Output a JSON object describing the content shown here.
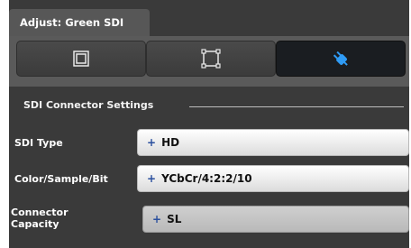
{
  "window": {
    "title": "Adjust: Green SDI"
  },
  "tabs": [
    {
      "name": "picture",
      "icon": "square-frame-icon",
      "selected": false
    },
    {
      "name": "crop",
      "icon": "crop-corners-icon",
      "selected": false
    },
    {
      "name": "connector",
      "icon": "plug-icon",
      "selected": true
    }
  ],
  "section": {
    "title": "SDI Connector Settings"
  },
  "fields": [
    {
      "label": "SDI Type",
      "value": "HD",
      "prefix": "+"
    },
    {
      "label": "Color/Sample/Bit",
      "value": "YCbCr/4:2:2/10",
      "prefix": "+"
    },
    {
      "label_line1": "Connector",
      "label_line2": "Capacity",
      "value": "SL",
      "prefix": "+",
      "enabled": false
    }
  ],
  "colors": {
    "accent": "#2f9bf5",
    "panel_bg": "#3a3a3a",
    "tabbar_bg": "#5a5a5a",
    "selected_tab": "#1a1d21"
  }
}
